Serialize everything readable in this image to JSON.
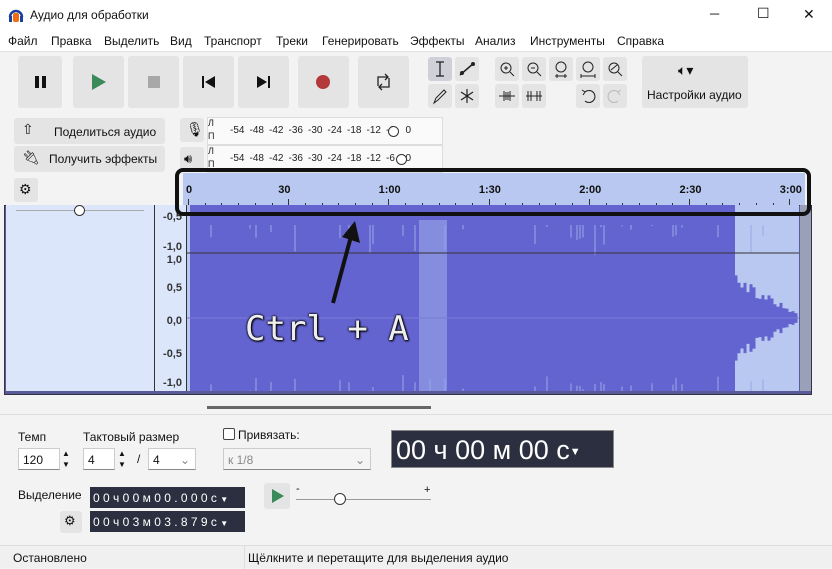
{
  "window": {
    "title": "Аудио для обработки",
    "minimize": "─",
    "maximize": "☐",
    "close": "✕"
  },
  "menu": [
    "Файл",
    "Правка",
    "Выделить",
    "Вид",
    "Транспорт",
    "Треки",
    "Генерировать",
    "Эффекты",
    "Анализ",
    "Инструменты",
    "Справка"
  ],
  "toolbar": {
    "audio_settings": "Настройки аудио",
    "share_audio": "Поделиться аудио",
    "get_effects": "Получить эффекты"
  },
  "meters": {
    "channel_l": "Л",
    "channel_r": "П",
    "record_ticks": [
      "-54",
      "-48",
      "-42",
      "-36",
      "-30",
      "-24",
      "-18",
      "-12",
      "-6",
      "0"
    ],
    "play_ticks": [
      "-54",
      "-48",
      "-42",
      "-36",
      "-30",
      "-24",
      "-18",
      "-12",
      "-6",
      "0"
    ]
  },
  "ruler": {
    "ticks": [
      "0",
      "30",
      "1:00",
      "1:30",
      "2:00",
      "2:30",
      "3:00"
    ]
  },
  "track": {
    "scale_top": [
      "-0,5",
      "-1,0"
    ],
    "scale_bottom": [
      "1,0",
      "0,5",
      "0,0",
      "-0,5",
      "-1,0"
    ]
  },
  "annotation": {
    "text": "Ctrl + A"
  },
  "bottom": {
    "tempo_label": "Темп",
    "tempo_value": "120",
    "meter_label": "Тактовый размер",
    "meter_num": "4",
    "meter_sep": "/",
    "meter_den": "4",
    "snap_label": "Привязать:",
    "snap_value": "к 1/8",
    "time_display": "00 ч 00 м 00 с",
    "selection_label": "Выделение",
    "sel_start": "0 0 ч 0 0 м 0 0 . 0 0 0 с",
    "sel_end": "0 0 ч 0 3 м 0 3 . 8 7 9 с",
    "speed_minus": "-",
    "speed_plus": "+"
  },
  "status": {
    "state": "Остановлено",
    "hint": "Щёлкните и перетащите для выделения аудио"
  },
  "colors": {
    "wave": "#6464d0",
    "wave_light": "#b8c8f0",
    "panel": "#dbe6fb",
    "record": "#b33a3a",
    "play": "#3a8a5a"
  }
}
